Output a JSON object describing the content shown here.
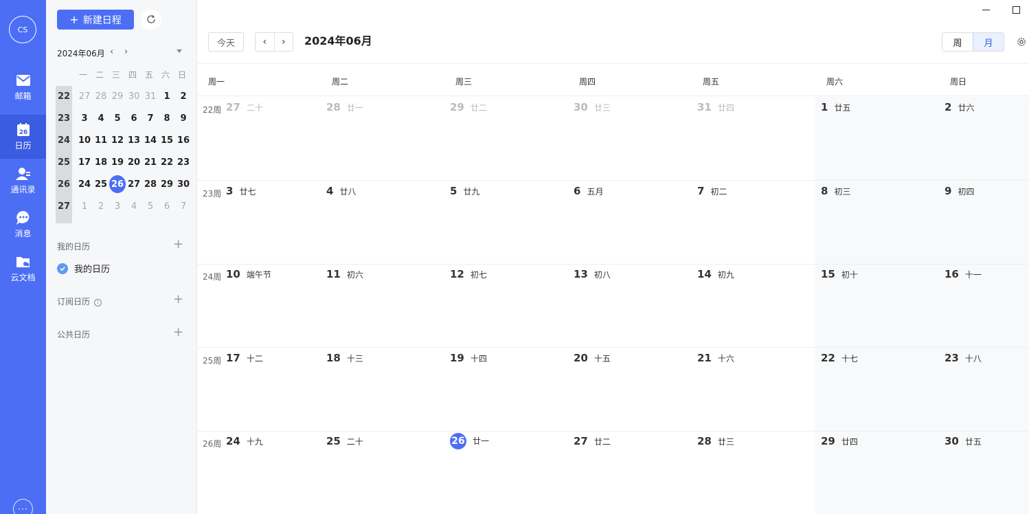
{
  "rail": {
    "avatar": "CS",
    "items": [
      {
        "label": "邮箱",
        "icon": "mail-icon"
      },
      {
        "label": "日历",
        "icon": "calendar-icon",
        "badge": "26"
      },
      {
        "label": "通讯录",
        "icon": "contacts-icon"
      },
      {
        "label": "消息",
        "icon": "message-icon"
      },
      {
        "label": "云文档",
        "icon": "cloud-docs-icon"
      }
    ],
    "more": "···"
  },
  "sidebar": {
    "new_button": "新建日程",
    "mini_month": "2024年06月",
    "weekdays": [
      "一",
      "二",
      "三",
      "四",
      "五",
      "六",
      "日"
    ],
    "rows": [
      {
        "week": "22",
        "days": [
          "27",
          "28",
          "29",
          "30",
          "31",
          "1",
          "2"
        ]
      },
      {
        "week": "23",
        "days": [
          "3",
          "4",
          "5",
          "6",
          "7",
          "8",
          "9"
        ]
      },
      {
        "week": "24",
        "days": [
          "10",
          "11",
          "12",
          "13",
          "14",
          "15",
          "16"
        ]
      },
      {
        "week": "25",
        "days": [
          "17",
          "18",
          "19",
          "20",
          "21",
          "22",
          "23"
        ]
      },
      {
        "week": "26",
        "days": [
          "24",
          "25",
          "26",
          "27",
          "28",
          "29",
          "30"
        ]
      },
      {
        "week": "27",
        "days": [
          "1",
          "2",
          "3",
          "4",
          "5",
          "6",
          "7"
        ]
      }
    ],
    "my_calendars_title": "我的日历",
    "my_calendar_item": "我的日历",
    "subscribed_title": "订阅日历",
    "public_title": "公共日历"
  },
  "toolbar": {
    "today": "今天",
    "prev": "‹",
    "next": "›",
    "month_title": "2024年06月",
    "view_week": "周",
    "view_month": "月"
  },
  "calendar": {
    "weekdays": [
      "周一",
      "周二",
      "周三",
      "周四",
      "周五",
      "周六",
      "周日"
    ],
    "weeks": [
      {
        "label": "22周",
        "days": [
          {
            "d": "27",
            "l": "二十",
            "other": true
          },
          {
            "d": "28",
            "l": "廿一",
            "other": true
          },
          {
            "d": "29",
            "l": "廿二",
            "other": true
          },
          {
            "d": "30",
            "l": "廿三",
            "other": true
          },
          {
            "d": "31",
            "l": "廿四",
            "other": true
          },
          {
            "d": "1",
            "l": "廿五"
          },
          {
            "d": "2",
            "l": "廿六"
          }
        ]
      },
      {
        "label": "23周",
        "days": [
          {
            "d": "3",
            "l": "廿七"
          },
          {
            "d": "4",
            "l": "廿八"
          },
          {
            "d": "5",
            "l": "廿九"
          },
          {
            "d": "6",
            "l": "五月"
          },
          {
            "d": "7",
            "l": "初二"
          },
          {
            "d": "8",
            "l": "初三"
          },
          {
            "d": "9",
            "l": "初四"
          }
        ]
      },
      {
        "label": "24周",
        "days": [
          {
            "d": "10",
            "l": "端午节"
          },
          {
            "d": "11",
            "l": "初六"
          },
          {
            "d": "12",
            "l": "初七"
          },
          {
            "d": "13",
            "l": "初八"
          },
          {
            "d": "14",
            "l": "初九"
          },
          {
            "d": "15",
            "l": "初十"
          },
          {
            "d": "16",
            "l": "十一"
          }
        ]
      },
      {
        "label": "25周",
        "days": [
          {
            "d": "17",
            "l": "十二"
          },
          {
            "d": "18",
            "l": "十三"
          },
          {
            "d": "19",
            "l": "十四"
          },
          {
            "d": "20",
            "l": "十五"
          },
          {
            "d": "21",
            "l": "十六"
          },
          {
            "d": "22",
            "l": "十七"
          },
          {
            "d": "23",
            "l": "十八"
          }
        ]
      },
      {
        "label": "26周",
        "days": [
          {
            "d": "24",
            "l": "十九"
          },
          {
            "d": "25",
            "l": "二十"
          },
          {
            "d": "26",
            "l": "廿一",
            "today": true
          },
          {
            "d": "27",
            "l": "廿二"
          },
          {
            "d": "28",
            "l": "廿三"
          },
          {
            "d": "29",
            "l": "廿四"
          },
          {
            "d": "30",
            "l": "廿五"
          }
        ]
      }
    ]
  },
  "colors": {
    "accent": "#4c6ef5",
    "rail_active": "#3b5be0"
  }
}
